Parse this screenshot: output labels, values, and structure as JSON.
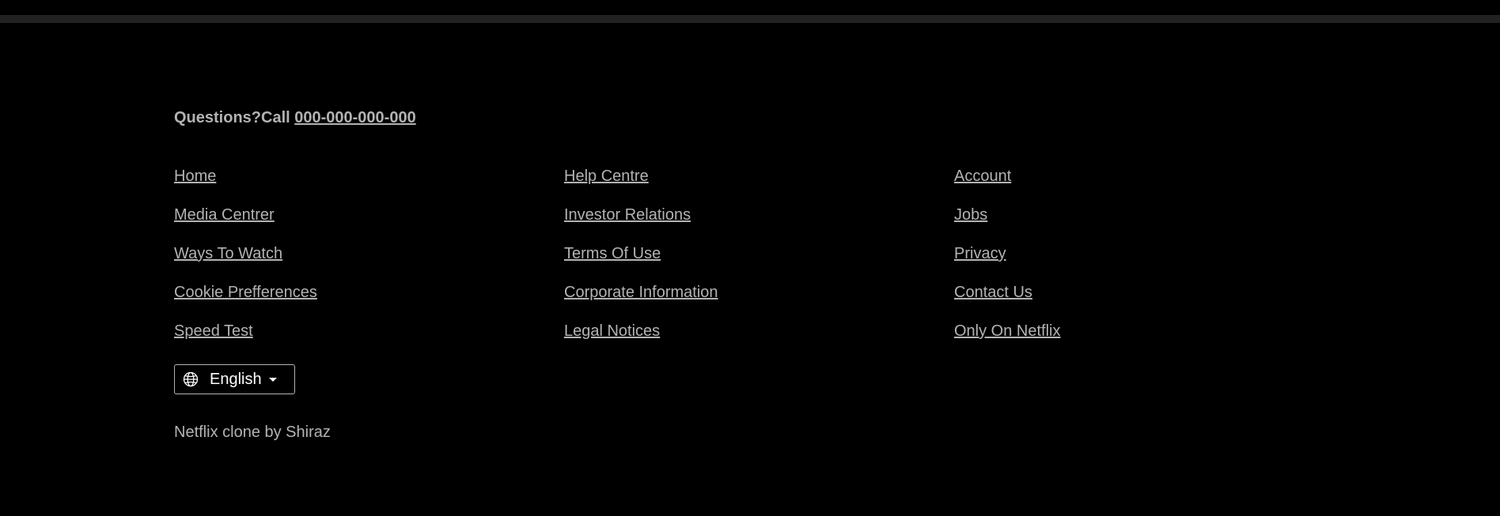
{
  "footer": {
    "questions_label": "Questions?Call ",
    "phone": "000-000-000-000",
    "links": [
      {
        "label": "Home"
      },
      {
        "label": "Help Centre"
      },
      {
        "label": "Account"
      },
      {
        "label": "Media Centrer"
      },
      {
        "label": "Investor Relations"
      },
      {
        "label": "Jobs"
      },
      {
        "label": "Ways To Watch"
      },
      {
        "label": "Terms Of Use"
      },
      {
        "label": "Privacy"
      },
      {
        "label": "Cookie Prefferences"
      },
      {
        "label": "Corporate Information"
      },
      {
        "label": "Contact Us"
      },
      {
        "label": "Speed Test"
      },
      {
        "label": "Legal Notices"
      },
      {
        "label": "Only On Netflix"
      }
    ],
    "language": {
      "selected": "English",
      "icon": "globe-icon"
    },
    "credit": "Netflix clone by Shiraz"
  },
  "colors": {
    "background": "#000000",
    "divider": "#222222",
    "link_text": "#b3b3b3",
    "button_text": "#ffffff"
  }
}
